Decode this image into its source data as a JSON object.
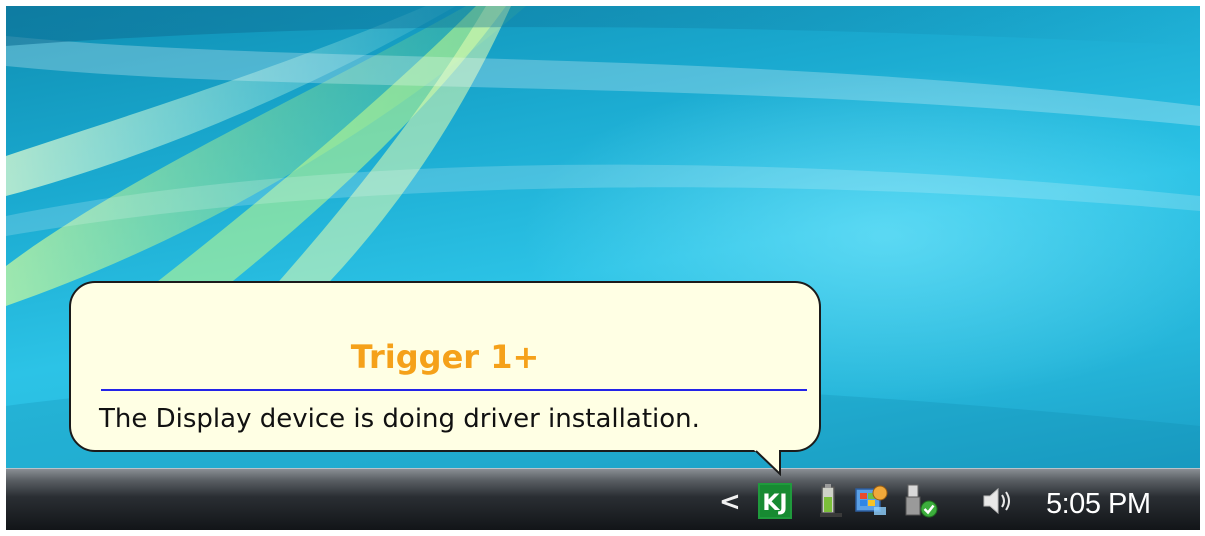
{
  "notification": {
    "title": "Trigger 1+",
    "message": "The Display device is doing driver installation.",
    "title_color": "#f5a11a",
    "rule_color": "#2323e8",
    "background": "#ffffe4"
  },
  "taskbar": {
    "show_hidden_icons": "<",
    "tray_icons": [
      {
        "name": "kj-trigger-app-icon",
        "glyph": "KJ"
      },
      {
        "name": "power-battery-icon"
      },
      {
        "name": "windows-security-flag-icon"
      },
      {
        "name": "safely-remove-hardware-icon"
      },
      {
        "name": "volume-icon"
      }
    ],
    "clock": "5:05 PM"
  },
  "colors": {
    "desktop_accent": "#2cc3e6",
    "kj_green": "#1f9a3c"
  }
}
